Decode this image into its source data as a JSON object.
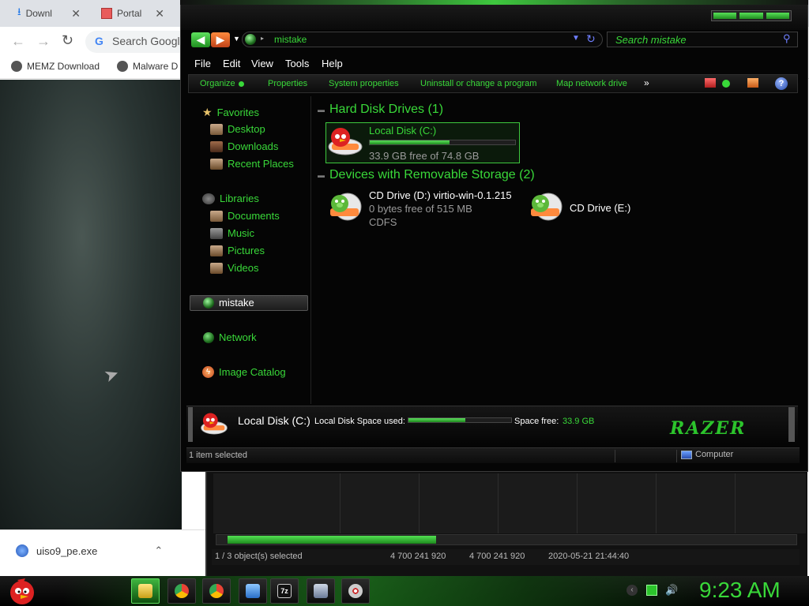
{
  "browser": {
    "tabs": [
      {
        "label": "Downl"
      },
      {
        "label": "Portal"
      }
    ],
    "omnibox_placeholder": "Search Googl",
    "bookmarks": [
      {
        "label": "MEMZ Download"
      },
      {
        "label": "Malware D"
      }
    ],
    "download_item": "uiso9_pe.exe"
  },
  "explorer": {
    "address": "mistake",
    "search_placeholder": "Search mistake",
    "menu": [
      "File",
      "Edit",
      "View",
      "Tools",
      "Help"
    ],
    "commands": [
      "Organize",
      "Properties",
      "System properties",
      "Uninstall or change a program",
      "Map network drive"
    ],
    "more_glyph": "»",
    "help_glyph": "?",
    "nav": {
      "favorites": "Favorites",
      "desktop": "Desktop",
      "downloads": "Downloads",
      "recent": "Recent Places",
      "libraries": "Libraries",
      "documents": "Documents",
      "music": "Music",
      "pictures": "Pictures",
      "videos": "Videos",
      "computer": "mistake",
      "network": "Network",
      "image_catalog": "Image Catalog"
    },
    "groups": {
      "hdd": "Hard Disk Drives (1)",
      "removable": "Devices with Removable Storage (2)"
    },
    "drives": {
      "c_name": "Local Disk (C:)",
      "c_free": "33.9 GB free of 74.8 GB",
      "c_used_fraction": 0.55,
      "d_name": "CD Drive (D:) virtio-win-0.1.215",
      "d_free": "0 bytes free of 515 MB",
      "d_fs": "CDFS",
      "e_name": "CD Drive (E:)"
    },
    "details": {
      "name": "Local Disk (C:)",
      "space_used_label": "Local Disk Space used:",
      "space_free_label": "Space free:",
      "space_free_value": "33.9 GB",
      "brand": "RAZER"
    },
    "status": {
      "selected": "1 item selected",
      "location": "Computer"
    }
  },
  "back_window": {
    "status": "1 / 3 object(s) selected",
    "size1": "4 700 241 920",
    "size2": "4 700 241 920",
    "date": "2020-05-21 21:44:40",
    "scroll_fraction": 0.36
  },
  "taskbar": {
    "clock": "9:23 AM"
  },
  "colors": {
    "accent_green": "#39d839",
    "window_bg": "#050505"
  }
}
